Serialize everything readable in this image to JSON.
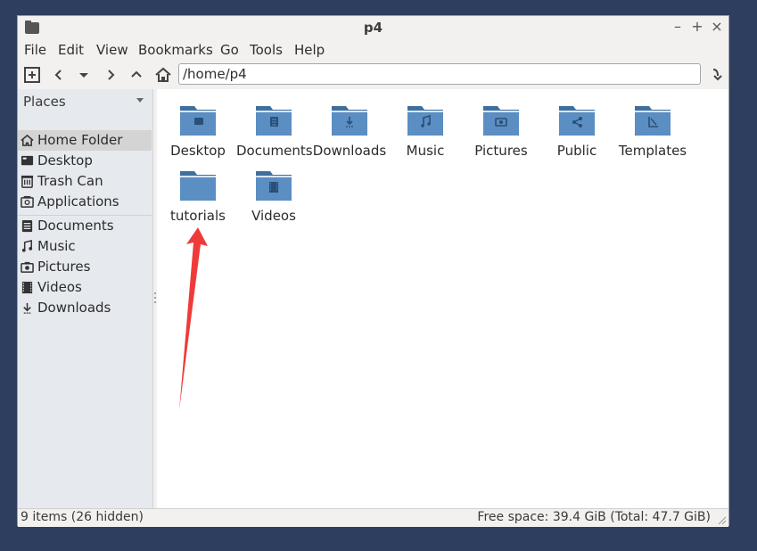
{
  "window": {
    "title": "p4",
    "controls": {
      "minimize": "–",
      "maximize": "+",
      "close": "×"
    }
  },
  "menu": [
    "File",
    "Edit",
    "View",
    "Bookmarks",
    "Go",
    "Tools",
    "Help"
  ],
  "toolbar": {
    "location": "/home/p4"
  },
  "sidebar": {
    "header": "Places",
    "items": [
      {
        "label": "Home Folder",
        "icon": "home-icon",
        "selected": true
      },
      {
        "label": "Desktop",
        "icon": "desktop-icon"
      },
      {
        "label": "Trash Can",
        "icon": "trash-icon"
      },
      {
        "label": "Applications",
        "icon": "applications-icon"
      },
      {
        "label": "Documents",
        "icon": "documents-icon"
      },
      {
        "label": "Music",
        "icon": "music-icon"
      },
      {
        "label": "Pictures",
        "icon": "pictures-icon"
      },
      {
        "label": "Videos",
        "icon": "videos-icon"
      },
      {
        "label": "Downloads",
        "icon": "downloads-icon"
      }
    ]
  },
  "files": [
    {
      "name": "Desktop",
      "icon": "folder-desktop-icon"
    },
    {
      "name": "Documents",
      "icon": "folder-documents-icon"
    },
    {
      "name": "Downloads",
      "icon": "folder-downloads-icon"
    },
    {
      "name": "Music",
      "icon": "folder-music-icon"
    },
    {
      "name": "Pictures",
      "icon": "folder-pictures-icon"
    },
    {
      "name": "Public",
      "icon": "folder-public-icon"
    },
    {
      "name": "Templates",
      "icon": "folder-templates-icon"
    },
    {
      "name": "tutorials",
      "icon": "folder-icon"
    },
    {
      "name": "Videos",
      "icon": "folder-videos-icon"
    }
  ],
  "status": {
    "items": "9 items (26 hidden)",
    "free_space": "Free space: 39.4 GiB (Total: 47.7 GiB)"
  },
  "colors": {
    "desktop_bg": "#2d3e5e",
    "folder_blue": "#5b8ec2",
    "annotation_arrow": "#f03a3a"
  }
}
